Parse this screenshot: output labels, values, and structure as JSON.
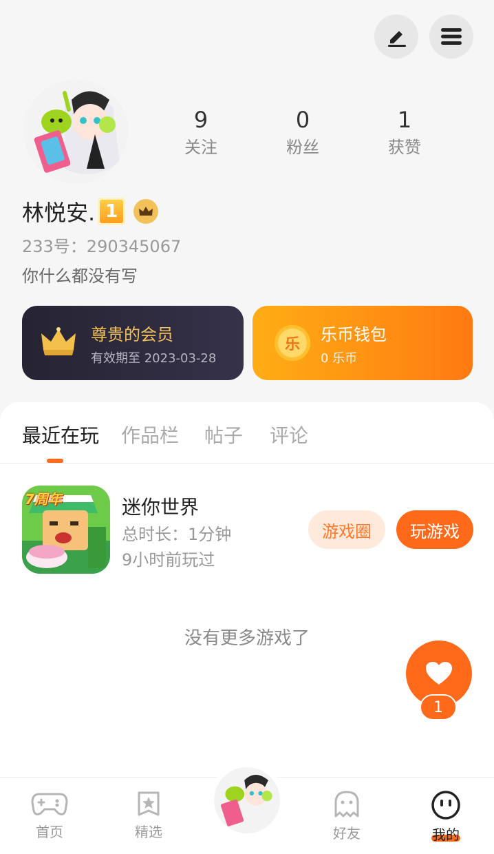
{
  "profile": {
    "name": "林悦安.",
    "level_badge": "1",
    "id_line": "233号：290345067",
    "bio": "你什么都没有写"
  },
  "stats": [
    {
      "value": "9",
      "label": "关注"
    },
    {
      "value": "0",
      "label": "粉丝"
    },
    {
      "value": "1",
      "label": "获赞"
    }
  ],
  "vip_card": {
    "title": "尊贵的会员",
    "subtitle": "有效期至 2023-03-28"
  },
  "wallet_card": {
    "coin_glyph": "乐",
    "title": "乐币钱包",
    "subtitle": "0 乐币"
  },
  "tabs": [
    {
      "label": "最近在玩",
      "active": true
    },
    {
      "label": "作品栏",
      "active": false
    },
    {
      "label": "帖子",
      "active": false
    },
    {
      "label": "评论",
      "active": false
    }
  ],
  "game": {
    "icon_text": "7周年",
    "name": "迷你世界",
    "duration": "总时长：1分钟",
    "last_played": "9小时前玩过",
    "circle_button": "游戏圈",
    "play_button": "玩游戏"
  },
  "empty_hint": "没有更多游戏了",
  "like_fab": {
    "count": "1"
  },
  "nav": [
    {
      "label": "首页",
      "icon": "gamepad-icon"
    },
    {
      "label": "精选",
      "icon": "star-badge-icon"
    },
    {
      "label": "好友",
      "icon": "ghost-icon"
    },
    {
      "label": "我的",
      "icon": "smiley-icon",
      "active": true
    }
  ],
  "colors": {
    "accent": "#ff6a1a",
    "accent_light": "#ffe9db",
    "vip_gold": "#f2c15a",
    "wallet_gradient_start": "#ffad14"
  }
}
